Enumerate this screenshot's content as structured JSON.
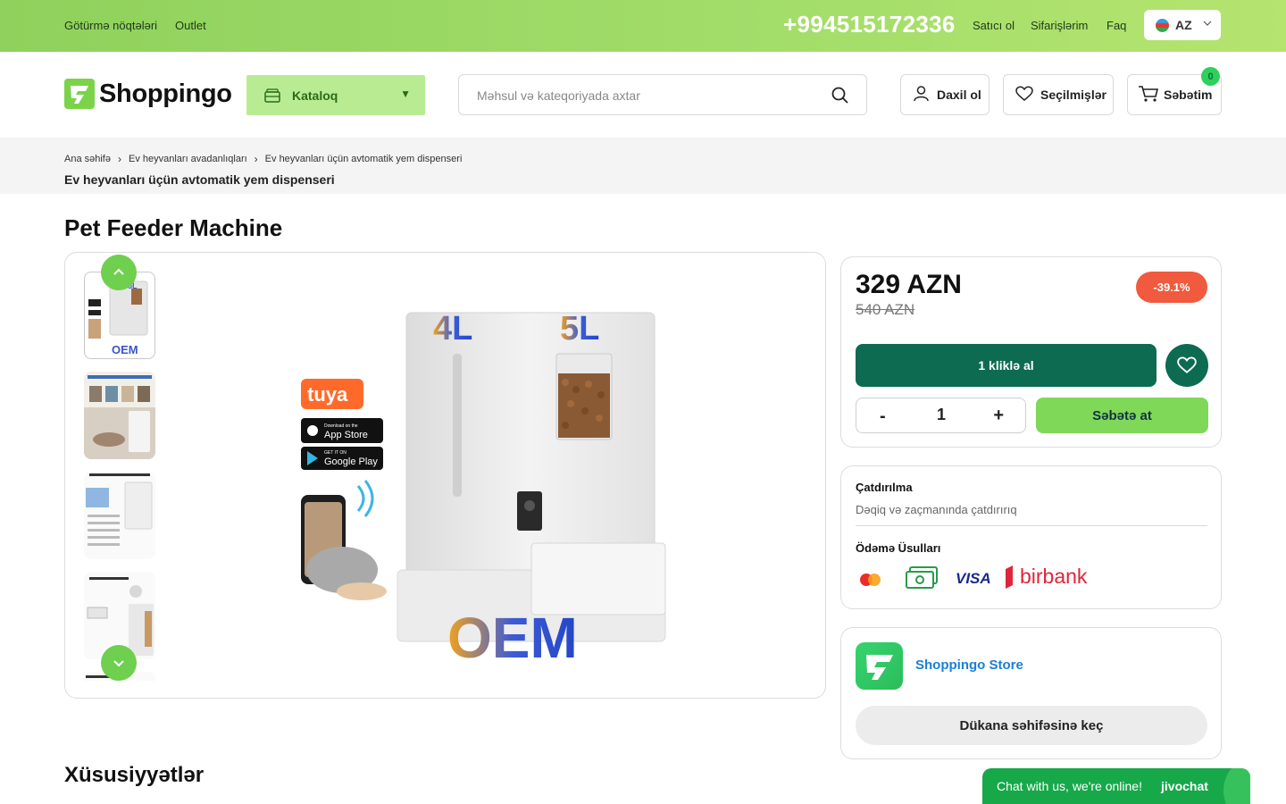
{
  "topbar": {
    "links_left": [
      "Götürmə nöqtələri",
      "Outlet"
    ],
    "phone": "+994515172336",
    "links_right": [
      "Satıcı ol",
      "Sifarişlərim",
      "Faq"
    ],
    "language": "AZ",
    "color": "#8fd15c"
  },
  "header": {
    "logo_text": "Shoppingo",
    "catalog_label": "Kataloq",
    "search_placeholder": "Məhsul və kateqoriyada axtar",
    "login_label": "Daxil ol",
    "favorites_label": "Seçilmişlər",
    "cart_label": "Səbətim",
    "cart_count": "0"
  },
  "breadcrumb": {
    "items": [
      "Ana səhifə",
      "Ev heyvanları avadanlıqları",
      "Ev heyvanları üçün avtomatik yem dispenseri"
    ],
    "title": "Ev heyvanları üçün avtomatik yem dispenseri"
  },
  "product": {
    "title": "Pet Feeder Machine",
    "image_labels": {
      "capacity_left": "4L",
      "capacity_right": "5L",
      "brand": "OEM",
      "app": "tuya",
      "store1": "App Store",
      "store2": "Google Play",
      "store1_top": "Download on the",
      "store2_top": "GET IT ON"
    },
    "thumb_captions": [
      "OEM",
      "",
      "",
      ""
    ],
    "price": "329 AZN",
    "old_price": "540 AZN",
    "discount": "-39.1%",
    "one_click_label": "1 kliklə al",
    "quantity": "1",
    "minus_label": "-",
    "plus_label": "+",
    "add_to_cart_label": "Səbətə at"
  },
  "delivery": {
    "title": "Çatdırılma",
    "subtitle": "Dəqiq və zaçmanında çatdırırıq",
    "payment_title": "Ödəmə Üsulları",
    "payment_methods": [
      "mastercard",
      "cash",
      "VISA",
      "birbank"
    ]
  },
  "store": {
    "name": "Shoppingo Store",
    "button_label": "Dükana səhifəsinə keç"
  },
  "features_title": "Xüsusiyyətlər",
  "chat": {
    "message": "Chat with us, we're online!",
    "brand": "jivochat"
  },
  "colors": {
    "accent_green": "#7fd858",
    "dark_green": "#0d6b52",
    "discount_red": "#f05a3e",
    "store_blue": "#1b7fd8"
  }
}
